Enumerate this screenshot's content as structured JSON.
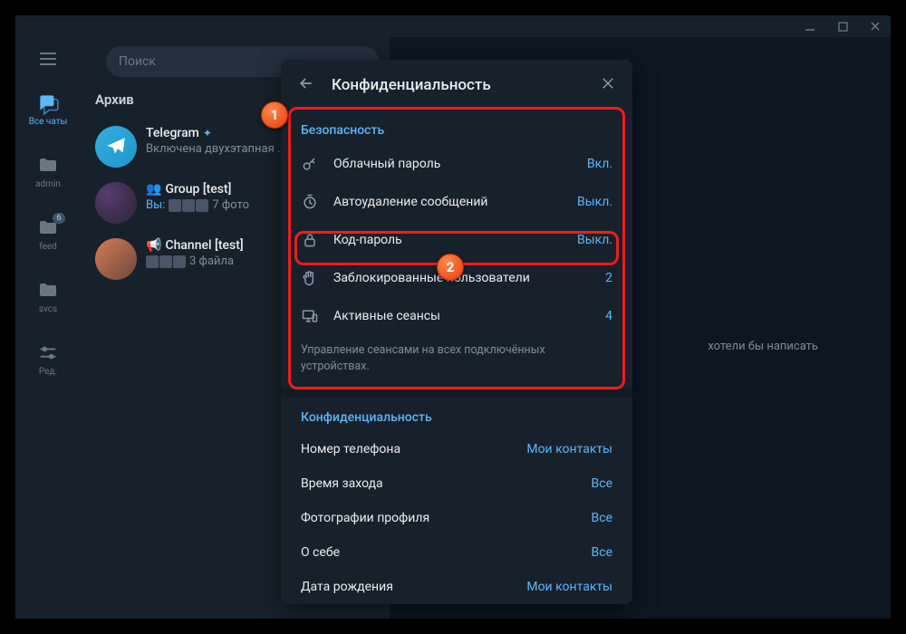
{
  "titlebar": {},
  "nav": {
    "items": [
      {
        "label": "Все чаты"
      },
      {
        "label": "admin"
      },
      {
        "label": "feed",
        "badge": "6"
      },
      {
        "label": "svcs"
      },
      {
        "label": "Ред."
      }
    ]
  },
  "search": {
    "placeholder": "Поиск"
  },
  "archive": {
    "title": "Архив"
  },
  "chats": [
    {
      "title": "Telegram",
      "subtitle": "Включена двухэтапная …"
    },
    {
      "title": "Group [test]",
      "you": "Вы:",
      "suffix": "7 фото"
    },
    {
      "title": "Channel [test]",
      "suffix": "3 файла"
    }
  ],
  "main_hint": "хотели бы написать",
  "panel": {
    "title": "Конфиденциальность",
    "section_security": "Безопасность",
    "rows": [
      {
        "label": "Облачный пароль",
        "value": "Вкл."
      },
      {
        "label": "Автоудаление сообщений",
        "value": "Выкл."
      },
      {
        "label": "Код-пароль",
        "value": "Выкл."
      },
      {
        "label": "Заблокированные пользователи",
        "value": "2"
      },
      {
        "label": "Активные сеансы",
        "value": "4"
      }
    ],
    "hint": "Управление сеансами на всех подключённых устройствах.",
    "section_privacy": "Конфиденциальность",
    "privacy_rows": [
      {
        "label": "Номер телефона",
        "value": "Мои контакты"
      },
      {
        "label": "Время захода",
        "value": "Все"
      },
      {
        "label": "Фотографии профиля",
        "value": "Все"
      },
      {
        "label": "О себе",
        "value": "Все"
      },
      {
        "label": "Дата рождения",
        "value": "Мои контакты"
      }
    ]
  },
  "markers": {
    "m1": "1",
    "m2": "2"
  }
}
